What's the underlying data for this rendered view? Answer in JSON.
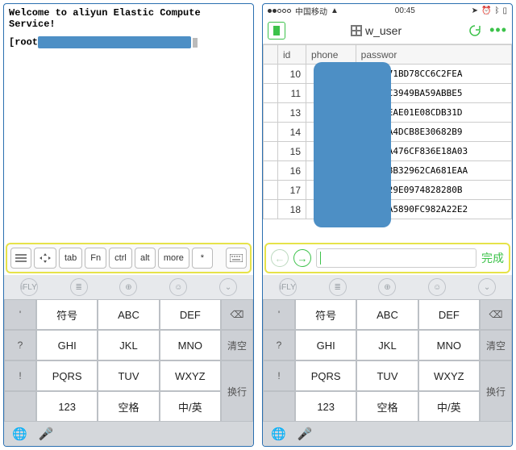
{
  "left": {
    "terminal": {
      "welcome": "Welcome to aliyun Elastic Compute Service!",
      "prompt_prefix": "[root"
    },
    "fn_keys": [
      "tab",
      "Fn",
      "ctrl",
      "alt",
      "more",
      "*"
    ]
  },
  "right": {
    "status": {
      "carrier": "中国移动",
      "time": "00:45"
    },
    "nav": {
      "title": "w_user"
    },
    "table": {
      "columns": [
        "",
        "id",
        "phone",
        "passwor"
      ],
      "rows": [
        {
          "id": "10",
          "hash": "C44A471BD78CC6C2FEA"
        },
        {
          "id": "11",
          "hash": "E10ADC3949BA59ABBE5"
        },
        {
          "id": "13",
          "hash": "BCB1CEAE01E08CDB31D"
        },
        {
          "id": "14",
          "hash": "9CBF8A4DCB8E30682B9"
        },
        {
          "id": "15",
          "hash": "B2472A476CF836E18A03"
        },
        {
          "id": "16",
          "hash": "7442F8B32962CA681EAA"
        },
        {
          "id": "17",
          "hash": "FB95629E0974828280B"
        },
        {
          "id": "18",
          "hash": "89BDDA5890FC982A22E2"
        }
      ]
    },
    "edit": {
      "done": "完成"
    }
  },
  "keyboard": {
    "suggest_icons": [
      "iFLY",
      "≣",
      "⊕",
      "☺",
      "⌄"
    ],
    "rows": [
      [
        "'",
        "符号",
        "ABC",
        "DEF",
        "⌫"
      ],
      [
        "?",
        "GHI",
        "JKL",
        "MNO",
        "清空"
      ],
      [
        "!",
        "PQRS",
        "TUV",
        "WXYZ",
        "换行"
      ],
      [
        "",
        "123",
        "空格",
        "中/英",
        ""
      ]
    ],
    "bottom_icons": [
      "🌐",
      "🎤"
    ]
  }
}
